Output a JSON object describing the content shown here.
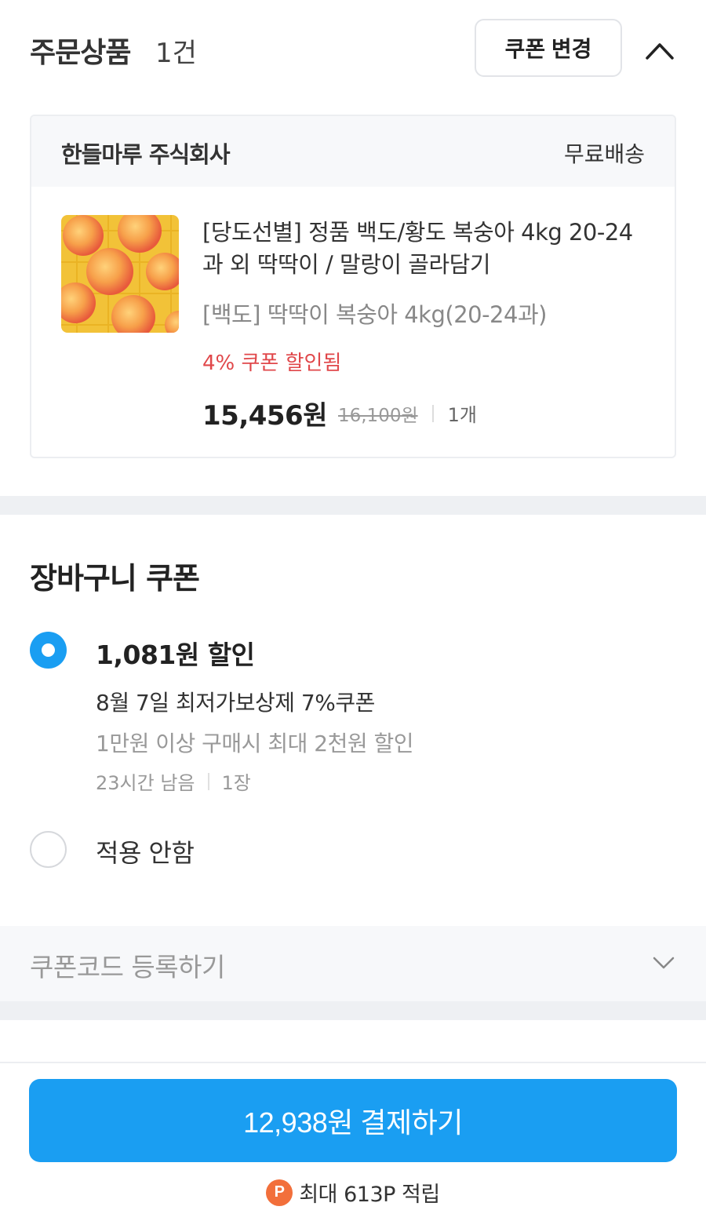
{
  "order": {
    "title": "주문상품",
    "count": "1건",
    "change_coupon_button": "쿠폰 변경",
    "collapse_icon": "chevron-up-icon"
  },
  "seller": {
    "name": "한들마루 주식회사",
    "shipping": "무료배송"
  },
  "product": {
    "thumbnail_icon": "peach-product-image",
    "name": "[당도선별] 정품 백도/황도 복숭아 4kg 20-24과 외 딱딱이 / 말랑이 골라담기",
    "option": "[백도] 딱딱이 복숭아 4kg(20-24과)",
    "coupon_applied": "4% 쿠폰 할인됨",
    "final_price": "15,456원",
    "original_price": "16,100원",
    "quantity": "1개"
  },
  "cart_coupon": {
    "title": "장바구니 쿠폰",
    "options": [
      {
        "selected": true,
        "amount": "1,081원 할인",
        "name": "8월 7일 최저가보상제 7%쿠폰",
        "condition": "1만원 이상 구매시 최대 2천원 할인",
        "remaining": "23시간 남음",
        "count": "1장"
      },
      {
        "selected": false,
        "label": "적용 안함"
      }
    ]
  },
  "coupon_code": {
    "label": "쿠폰코드 등록하기",
    "expand_icon": "chevron-down-icon"
  },
  "payment": {
    "button_label": "12,938원 결제하기",
    "points_badge": "P",
    "points_text": "최대 613P 적립"
  },
  "colors": {
    "accent": "#1a9ef2",
    "discount": "#e0474a",
    "points": "#f26f3b"
  }
}
